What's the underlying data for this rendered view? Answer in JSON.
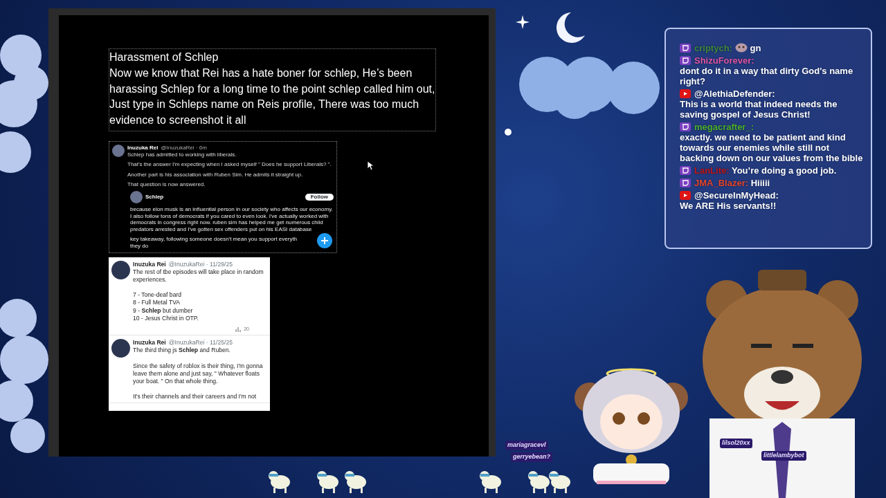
{
  "browser_window": {
    "document": {
      "title": "Harassment of Schlep",
      "paragraph": "Now we know that Rei has a hate boner for schlep, He’s been harassing Schlep for a long time to the point schlep called him out, Just type in Schleps name on Reis profile, There was too much evidence to screenshot it all"
    },
    "screenshot_1": {
      "author": "Inuzuka Rei",
      "handle": "@InuzukaRei · 6m",
      "paragraphs": [
        "Schlep has admitted to working with liberals.",
        "That's the answer I'm expecting when I asked myself \" Does he support Liberals? \".",
        "Another part is his association with Ruben Sim. He admits it straight up.",
        "That question is now answered."
      ],
      "quote": {
        "author": "Schlep",
        "follow_label": "Follow",
        "text": "because elon musk is an influential person in our society who affects our economy. I also follow tons of democrats if you cared to even look. i've actually worked with democrats in congress right now. ruben sim has helped me get numerous child predators arrested and I've gotten sex offenders put on his EASI database",
        "takeaway": "key takeaway, following someone doesn't mean you support everyth",
        "takeaway_end": "they do"
      }
    },
    "screenshot_2": {
      "tweets": [
        {
          "author": "Inuzuka Rei",
          "meta": "@InuzukaRei · 11/29/25",
          "paragraphs": [
            [
              "The rest of tbe episodes will take place in random experiences."
            ],
            [
              "7 - Tone-deaf bard",
              "8 - Full Metal TVA",
              "9 - **Schlep** but dumber",
              "10 - Jesus Christ in OTP."
            ]
          ],
          "views": "20"
        },
        {
          "author": "Inuzuka Rei",
          "meta": "@InuzukaRei · 11/25/25",
          "paragraphs": [
            [
              "The third thing js **Schlep** and Ruben."
            ],
            [
              "Since the safety of roblox is their thing, I'm gonna leave them alone and just say, \" Whatever floats your boat. \" On that whole thing."
            ],
            [
              "It's their channels and their careers and I'm not"
            ]
          ]
        }
      ]
    }
  },
  "chat": {
    "messages": [
      {
        "kind": "twitch",
        "username": "criptych:",
        "color": "#3f8a3a",
        "emote": true,
        "text": "gn"
      },
      {
        "kind": "twitch",
        "username": "ShizuForever:",
        "color": "#e0559e",
        "text": "dont do it in a way that dirty God's name right?"
      },
      {
        "kind": "youtube",
        "username": "@AlethiaDefender:",
        "color": "#ffffff",
        "text": "This is a world that indeed needs the saving gospel of Jesus Christ!"
      },
      {
        "kind": "twitch",
        "username": "megacrafter_:",
        "color": "#4caf2a",
        "text": "exactly. we need to be patient and kind towards our enemies while still not backing down on our values from the bible"
      },
      {
        "kind": "twitch",
        "username": "LanLite:",
        "color": "#c01818",
        "text": "You’re doing a good job."
      },
      {
        "kind": "twitch",
        "username": "JMA_Blazer:",
        "color": "#e5452a",
        "text": "Hiiiii"
      },
      {
        "kind": "youtube",
        "username": "@SecureInMyHead:",
        "color": "#ffffff",
        "text": "We ARE His servants!!"
      }
    ]
  },
  "viewer_names": [
    "mariagracevl",
    "gerryebean?",
    "lilsol20xx",
    "littlelambybot"
  ]
}
